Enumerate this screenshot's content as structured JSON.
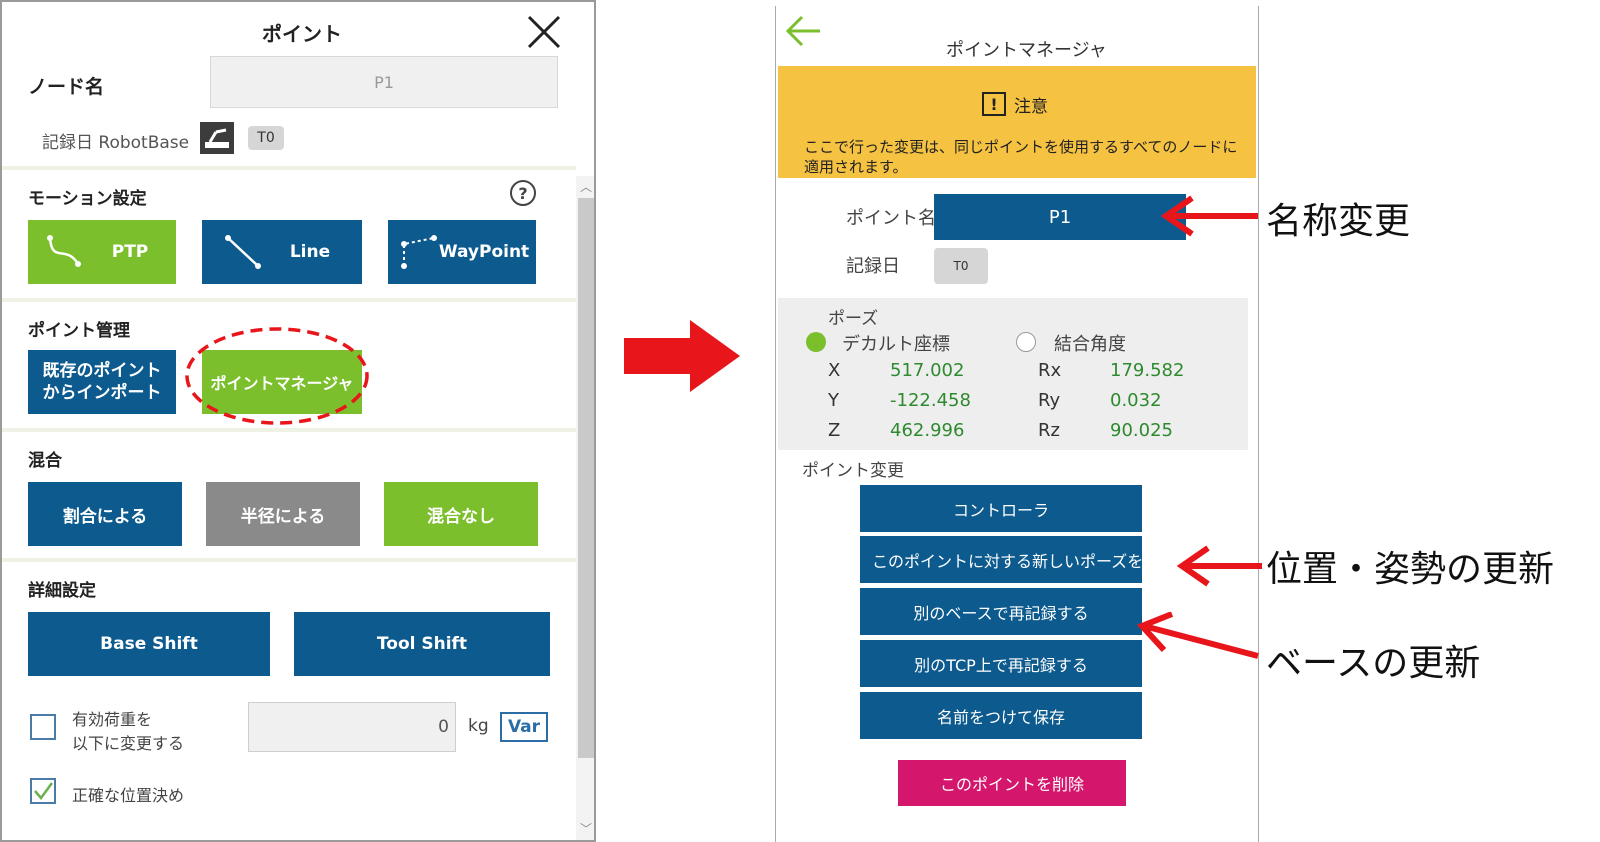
{
  "left": {
    "title": "ポイント",
    "node_name_label": "ノード名",
    "node_name_value": "P1",
    "record_label": "記録日 RobotBase",
    "record_tag": "T0",
    "motion_title": "モーション設定",
    "motion_buttons": [
      "PTP",
      "Line",
      "WayPoint"
    ],
    "point_mgmt_title": "ポイント管理",
    "import_label_1": "既存のポイント",
    "import_label_2": "からインポート",
    "point_manager_label": "ポイントマネージャ",
    "blend_title": "混合",
    "blend_buttons": [
      "割合による",
      "半径による",
      "混合なし"
    ],
    "detail_title": "詳細設定",
    "base_shift": "Base Shift",
    "tool_shift": "Tool Shift",
    "payload_label_1": "有効荷重を",
    "payload_label_2": "以下に変更する",
    "payload_value": "0",
    "payload_unit": "kg",
    "var_label": "Var",
    "precise_label": "正確な位置決め"
  },
  "right": {
    "title": "ポイントマネージャ",
    "warning_title": "注意",
    "warning_text_1": "ここで行った変更は、同じポイントを使用するすべてのノードに",
    "warning_text_2": "適用されます。",
    "point_name_label": "ポイント名",
    "point_name_value": "P1",
    "record_label": "記録日",
    "record_tag": "T0",
    "pose_title": "ポーズ",
    "cartesian_label": "デカルト座標",
    "joint_label": "結合角度",
    "pose": [
      {
        "label": "X",
        "value": "517.002",
        "rlabel": "Rx",
        "rvalue": "179.582"
      },
      {
        "label": "Y",
        "value": "-122.458",
        "rlabel": "Ry",
        "rvalue": "0.032"
      },
      {
        "label": "Z",
        "value": "462.996",
        "rlabel": "Rz",
        "rvalue": "90.025"
      }
    ],
    "change_title": "ポイント変更",
    "change_buttons": [
      "コントローラ",
      "このポイントに対する新しいポーズを上書き",
      "別のベースで再記録する",
      "別のTCP上で再記録する",
      "名前をつけて保存"
    ],
    "delete_label": "このポイントを削除"
  },
  "annotations": {
    "rename": "名称変更",
    "update_pose": "位置・姿勢の更新",
    "update_base": "ベースの更新"
  },
  "colors": {
    "blue": "#0c5a8e",
    "green": "#7bbf2c",
    "grey": "#8a8a8a",
    "warning": "#f5c242",
    "delete": "#d4176d",
    "arrow": "#e8161b"
  }
}
